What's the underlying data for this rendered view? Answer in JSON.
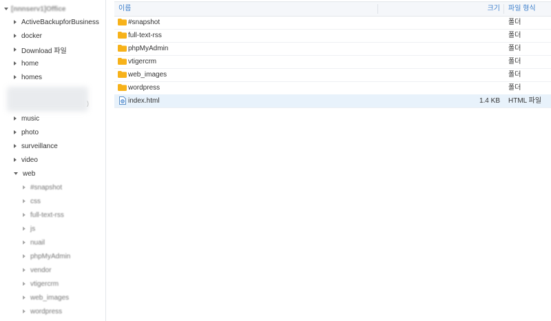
{
  "sidebar": {
    "root_label": "[nnnserv1]Office",
    "items": [
      {
        "label": "ActiveBackupforBusiness"
      },
      {
        "label": "docker"
      },
      {
        "label": "Download 파일"
      },
      {
        "label": "home"
      },
      {
        "label": "homes"
      },
      {
        "label": "music"
      },
      {
        "label": "photo"
      },
      {
        "label": "surveillance"
      },
      {
        "label": "video"
      },
      {
        "label": "web"
      }
    ],
    "web_children": [
      {
        "label": "#snapshot"
      },
      {
        "label": "css"
      },
      {
        "label": "full-text-rss"
      },
      {
        "label": "js"
      },
      {
        "label": "nuail"
      },
      {
        "label": "phpMyAdmin"
      },
      {
        "label": "vendor"
      },
      {
        "label": "vtigercrm"
      },
      {
        "label": "web_images"
      },
      {
        "label": "wordpress"
      }
    ]
  },
  "table": {
    "columns": {
      "name": "이름",
      "size": "크기",
      "type": "파일 형식"
    },
    "rows": [
      {
        "name": "#snapshot",
        "size": "",
        "type": "폴더",
        "icon": "folder-icon"
      },
      {
        "name": "full-text-rss",
        "size": "",
        "type": "폴더",
        "icon": "folder-icon"
      },
      {
        "name": "phpMyAdmin",
        "size": "",
        "type": "폴더",
        "icon": "folder-icon"
      },
      {
        "name": "vtigercrm",
        "size": "",
        "type": "폴더",
        "icon": "folder-icon"
      },
      {
        "name": "web_images",
        "size": "",
        "type": "폴더",
        "icon": "folder-icon"
      },
      {
        "name": "wordpress",
        "size": "",
        "type": "폴더",
        "icon": "folder-icon"
      },
      {
        "name": "index.html",
        "size": "1.4 KB",
        "type": "HTML 파일",
        "icon": "html-file-icon"
      }
    ]
  },
  "colors": {
    "accent": "#3b7ecb",
    "folder": "#f7b21a",
    "selected_row": "#e8f2fb"
  }
}
